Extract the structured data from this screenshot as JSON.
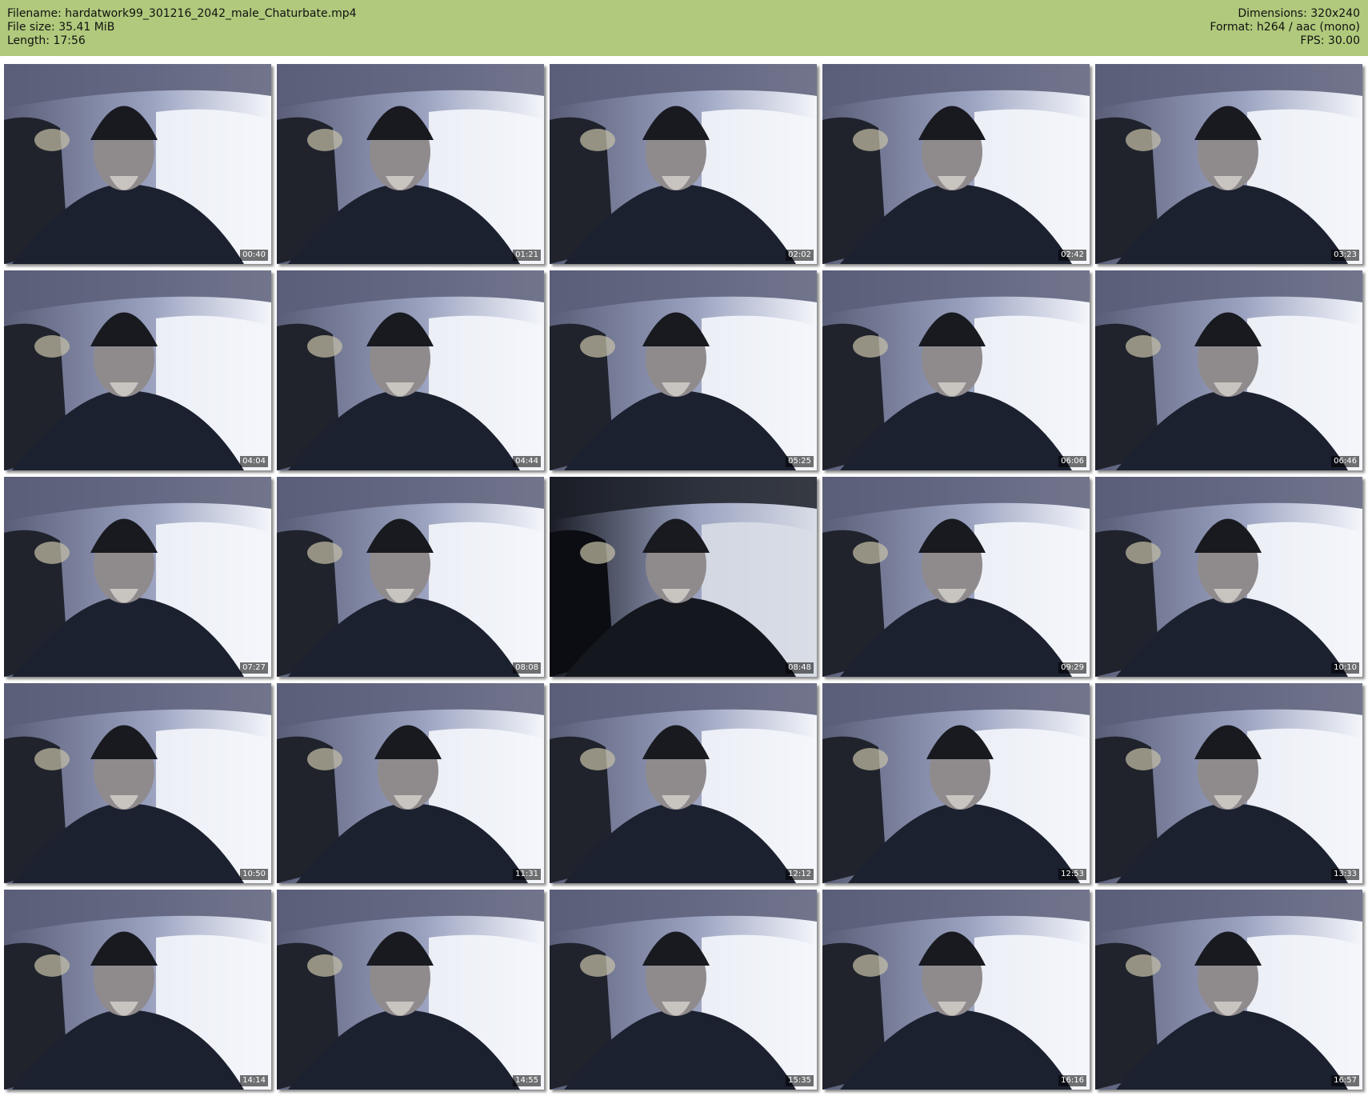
{
  "header": {
    "filename": "Filename: hardatwork99_301216_2042_male_Chaturbate.mp4",
    "filesize": "File size: 35.41 MiB",
    "length": "Length: 17:56",
    "dimensions": "Dimensions: 320x240",
    "format": "Format: h264 / aac (mono)",
    "fps": "FPS: 30.00"
  },
  "colors": {
    "header_bg": "#b0c97c"
  },
  "thumbnails": [
    {
      "time": "00:40"
    },
    {
      "time": "01:21"
    },
    {
      "time": "02:02"
    },
    {
      "time": "02:42"
    },
    {
      "time": "03:23"
    },
    {
      "time": "04:04"
    },
    {
      "time": "04:44"
    },
    {
      "time": "05:25"
    },
    {
      "time": "06:06"
    },
    {
      "time": "06:46"
    },
    {
      "time": "07:27"
    },
    {
      "time": "08:08"
    },
    {
      "time": "08:48"
    },
    {
      "time": "09:29"
    },
    {
      "time": "10:10"
    },
    {
      "time": "10:50"
    },
    {
      "time": "11:31"
    },
    {
      "time": "12:12"
    },
    {
      "time": "12:53"
    },
    {
      "time": "13:33"
    },
    {
      "time": "14:14"
    },
    {
      "time": "14:55"
    },
    {
      "time": "15:35"
    },
    {
      "time": "16:16"
    },
    {
      "time": "16:57"
    }
  ]
}
